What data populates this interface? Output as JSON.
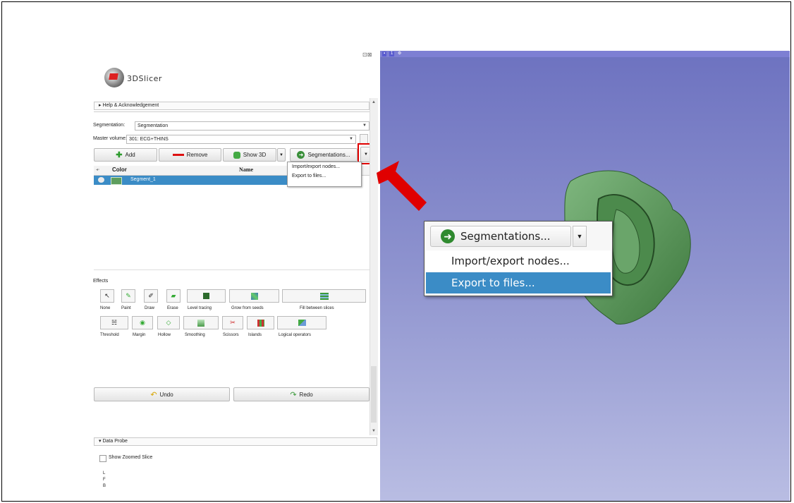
{
  "window": {
    "logo_text": "3DSlicer",
    "top_icons": "⊡⊠"
  },
  "help_section": {
    "label": "Help & Acknowledgement"
  },
  "segmentation": {
    "label": "Segmentation:",
    "value": "Segmentation",
    "master_label": "Master volume:",
    "master_value": "301: ECG+THINS"
  },
  "toolbar": {
    "add_label": "Add",
    "remove_label": "Remove",
    "show3d_label": "Show 3D",
    "segmentations_label": "Segmentations..."
  },
  "segment_table": {
    "headers": {
      "color": "Color",
      "name": "Name"
    },
    "rows": [
      {
        "name": "Segment_1"
      }
    ]
  },
  "small_menu": {
    "items": [
      "Import/export nodes...",
      "Export to files..."
    ]
  },
  "effects": {
    "title": "Effects",
    "row1": [
      "None",
      "Paint",
      "Draw",
      "Erase",
      "Level tracing",
      "Grow from seeds",
      "Fill between slices"
    ],
    "row2": [
      "Threshold",
      "Margin",
      "Hollow",
      "Smoothing",
      "Scissors",
      "Islands",
      "Logical operators"
    ]
  },
  "history": {
    "undo_label": "Undo",
    "redo_label": "Redo"
  },
  "data_probe": {
    "title": "Data Probe",
    "checkbox_label": "Show Zoomed Slice",
    "coords": [
      "L",
      "F",
      "B"
    ]
  },
  "viewer": {
    "tag_a": "▪",
    "tag_b": "1",
    "tag_c": "⚙"
  },
  "callout": {
    "button_label": "Segmentations...",
    "items": [
      "Import/export nodes...",
      "Export to files..."
    ],
    "highlighted_index": 1
  },
  "colors": {
    "highlight": "#3b8cc6",
    "segment": "#5e9e5e",
    "annotation": "#e00000",
    "viewer_top": "#6d72c0",
    "viewer_bottom": "#b9bde3"
  }
}
